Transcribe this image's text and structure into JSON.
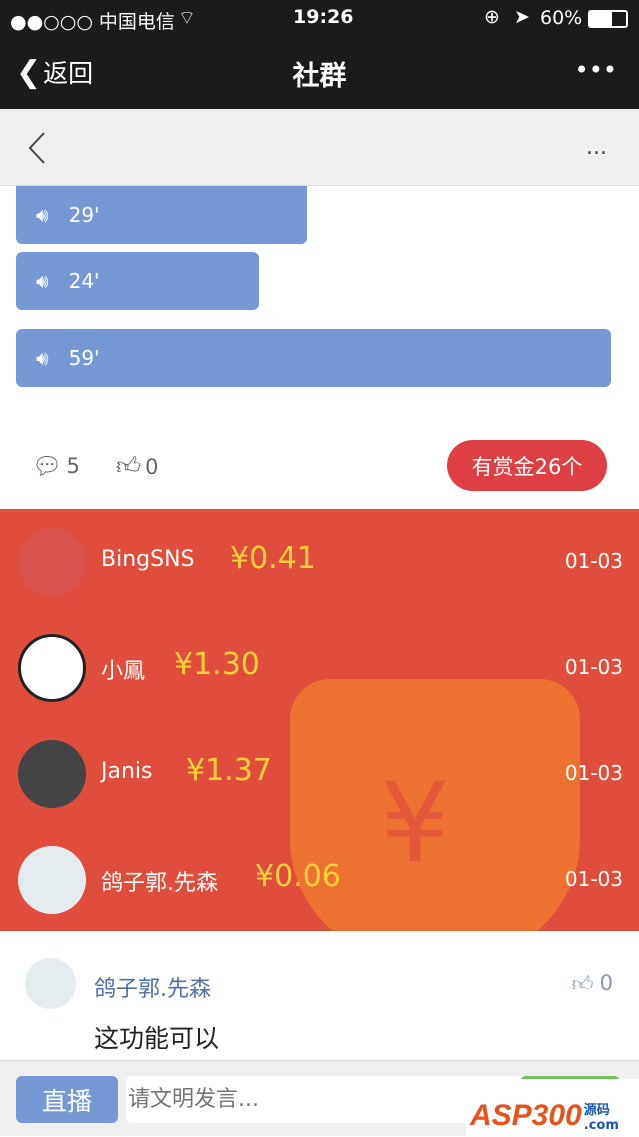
{
  "status_bar": {
    "carrier": "●●○○○ 中国电信",
    "time": "19:26",
    "battery": "60%"
  },
  "nav": {
    "back_label": "返回",
    "title": "社群",
    "more": "•••"
  },
  "subheader": {
    "more": "..."
  },
  "voices": [
    {
      "duration": "29'"
    },
    {
      "duration": "24'"
    },
    {
      "duration": "59'"
    }
  ],
  "stats": {
    "comments": "5",
    "likes": "0",
    "reward_label": "有赏金26个"
  },
  "rewards": [
    {
      "name": "BingSNS",
      "amount": "¥0.41",
      "date": "01-03"
    },
    {
      "name": "小鳳",
      "amount": "¥1.30",
      "date": "01-03"
    },
    {
      "name": "Janis",
      "amount": "¥1.37",
      "date": "01-03"
    },
    {
      "name": "鸽子郭.先森",
      "amount": "¥0.06",
      "date": "01-03"
    }
  ],
  "comment": {
    "name": "鸽子郭.先森",
    "likes": "0",
    "text": "这功能可以"
  },
  "bottom": {
    "live_label": "直播",
    "input_placeholder": "请文明发言..."
  },
  "watermark": {
    "text": "ASP300",
    "suffix": "源码",
    ".com": ".com"
  },
  "colors": {
    "voice": "#7698d4",
    "reward": "#dd3f45",
    "panel": "#e14d3c",
    "amount": "#fdd13a",
    "link": "#4f6fa6"
  }
}
